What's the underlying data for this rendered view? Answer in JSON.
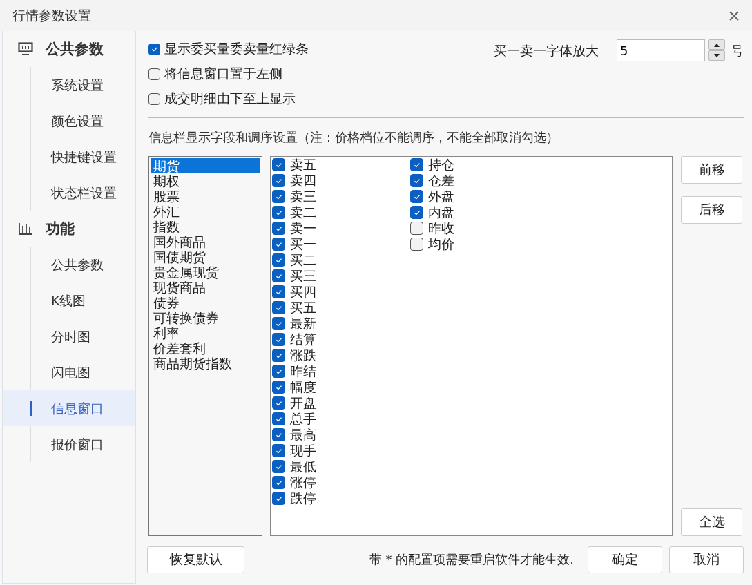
{
  "window": {
    "title": "行情参数设置",
    "close": "×"
  },
  "sidebar": [
    {
      "label": "公共参数",
      "kind": "monitor",
      "items": [
        {
          "label": "系统设置",
          "selected": false
        },
        {
          "label": "颜色设置",
          "selected": false
        },
        {
          "label": "快捷键设置",
          "selected": false
        },
        {
          "label": "状态栏设置",
          "selected": false
        }
      ]
    },
    {
      "label": "功能",
      "kind": "chart",
      "items": [
        {
          "label": "公共参数",
          "selected": false
        },
        {
          "label": "K线图",
          "selected": false
        },
        {
          "label": "分时图",
          "selected": false
        },
        {
          "label": "闪电图",
          "selected": false
        },
        {
          "label": "信息窗口",
          "selected": true
        },
        {
          "label": "报价窗口",
          "selected": false
        }
      ]
    }
  ],
  "options": [
    {
      "label": "显示委买量委卖量红绿条",
      "checked": true
    },
    {
      "label": "将信息窗口置于左侧",
      "checked": false
    },
    {
      "label": "成交明细由下至上显示",
      "checked": false
    }
  ],
  "font_size": {
    "label": "买一卖一字体放大",
    "value": "5",
    "unit": "号"
  },
  "section_title": "信息栏显示字段和调序设置（注：价格档位不能调序，不能全部取消勾选）",
  "categories": [
    {
      "label": "期货",
      "selected": true
    },
    {
      "label": "期权",
      "selected": false
    },
    {
      "label": "股票",
      "selected": false
    },
    {
      "label": "外汇",
      "selected": false
    },
    {
      "label": "指数",
      "selected": false
    },
    {
      "label": "国外商品",
      "selected": false
    },
    {
      "label": "国债期货",
      "selected": false
    },
    {
      "label": "贵金属现货",
      "selected": false
    },
    {
      "label": "现货商品",
      "selected": false
    },
    {
      "label": "债券",
      "selected": false
    },
    {
      "label": "可转换债券",
      "selected": false
    },
    {
      "label": "利率",
      "selected": false
    },
    {
      "label": "价差套利",
      "selected": false
    },
    {
      "label": "商品期货指数",
      "selected": false
    }
  ],
  "field_columns": [
    [
      {
        "label": "卖五",
        "checked": true
      },
      {
        "label": "卖四",
        "checked": true
      },
      {
        "label": "卖三",
        "checked": true
      },
      {
        "label": "卖二",
        "checked": true
      },
      {
        "label": "卖一",
        "checked": true
      },
      {
        "label": "买一",
        "checked": true
      },
      {
        "label": "买二",
        "checked": true
      },
      {
        "label": "买三",
        "checked": true
      },
      {
        "label": "买四",
        "checked": true
      },
      {
        "label": "买五",
        "checked": true
      },
      {
        "label": "最新",
        "checked": true
      },
      {
        "label": "结算",
        "checked": true
      },
      {
        "label": "涨跌",
        "checked": true
      },
      {
        "label": "昨结",
        "checked": true
      },
      {
        "label": "幅度",
        "checked": true
      },
      {
        "label": "开盘",
        "checked": true
      },
      {
        "label": "总手",
        "checked": true
      },
      {
        "label": "最高",
        "checked": true
      },
      {
        "label": "现手",
        "checked": true
      },
      {
        "label": "最低",
        "checked": true
      },
      {
        "label": "涨停",
        "checked": true
      },
      {
        "label": "跌停",
        "checked": true
      }
    ],
    [
      {
        "label": "持仓",
        "checked": true
      },
      {
        "label": "仓差",
        "checked": true
      },
      {
        "label": "外盘",
        "checked": true
      },
      {
        "label": "内盘",
        "checked": true
      },
      {
        "label": "昨收",
        "checked": false
      },
      {
        "label": "均价",
        "checked": false
      }
    ]
  ],
  "side_buttons": {
    "top": [
      "前移",
      "后移"
    ],
    "bottom": "全选"
  },
  "footer": {
    "reset": "恢复默认",
    "note": "带 * 的配置项需要重启软件才能生效.",
    "buttons": [
      "确定",
      "取消"
    ]
  }
}
